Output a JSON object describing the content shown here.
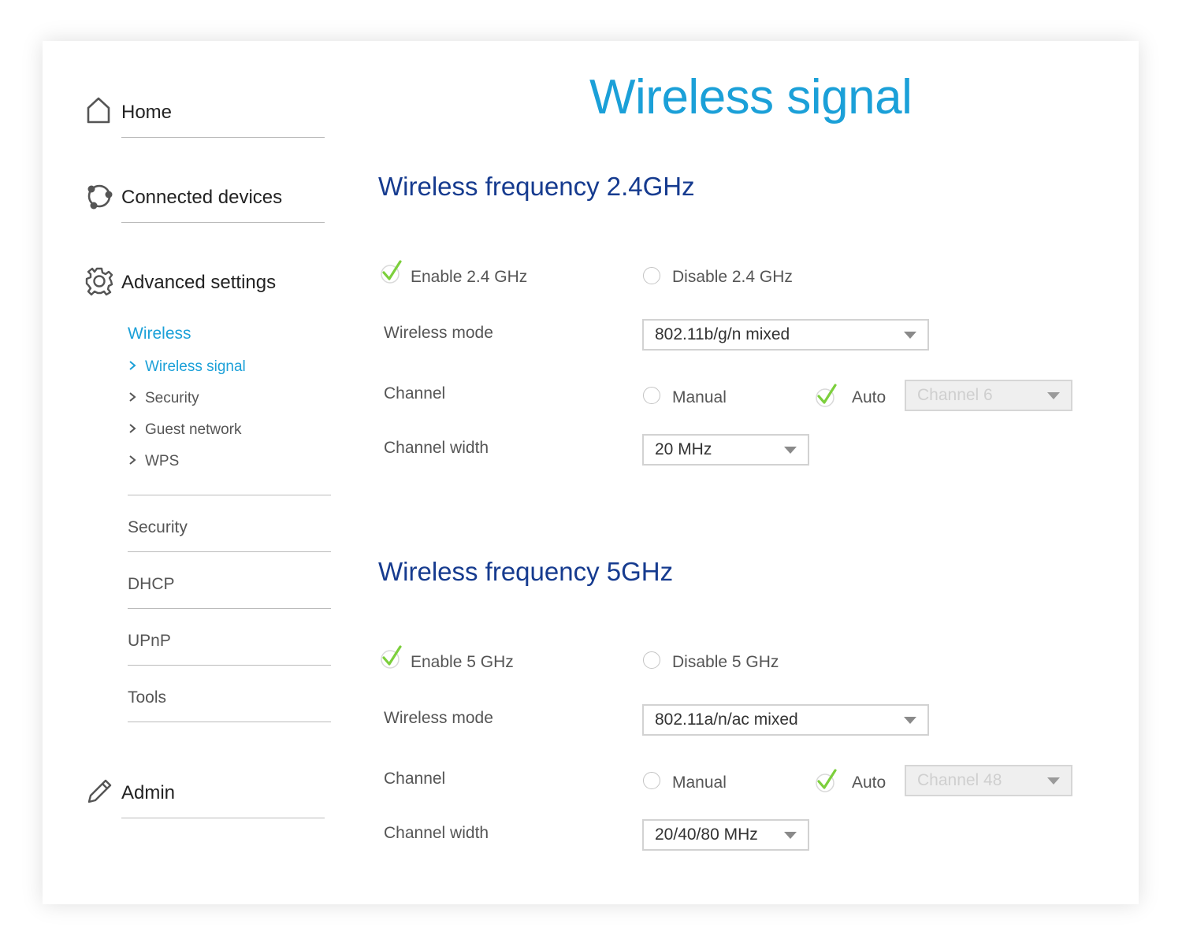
{
  "page": {
    "title": "Wireless signal"
  },
  "sidebar": {
    "home": "Home",
    "connected_devices": "Connected devices",
    "advanced_settings": "Advanced settings",
    "wireless_heading": "Wireless",
    "wireless_items": [
      "Wireless signal",
      "Security",
      "Guest network",
      "WPS"
    ],
    "advanced_items": [
      "Security",
      "DHCP",
      "UPnP",
      "Tools"
    ],
    "admin": "Admin",
    "active_item": "Wireless signal"
  },
  "band24": {
    "title": "Wireless frequency 2.4GHz",
    "enable_label": "Enable 2.4 GHz",
    "disable_label": "Disable 2.4 GHz",
    "mode_label": "Wireless mode",
    "mode_value": "802.11b/g/n mixed",
    "channel_label": "Channel",
    "manual_label": "Manual",
    "auto_label": "Auto",
    "channel_value": "Channel 6",
    "width_label": "Channel width",
    "width_value": "20 MHz"
  },
  "band5": {
    "title": "Wireless frequency 5GHz",
    "enable_label": "Enable 5 GHz",
    "disable_label": "Disable 5 GHz",
    "mode_label": "Wireless mode",
    "mode_value": "802.11a/n/ac mixed",
    "channel_label": "Channel",
    "manual_label": "Manual",
    "auto_label": "Auto",
    "channel_value": "Channel 48",
    "width_label": "Channel width",
    "width_value": "20/40/80 MHz"
  },
  "colors": {
    "accent": "#1ba0d8",
    "heading": "#163b8f",
    "check": "#7ccf3c"
  },
  "icons": [
    "home-icon",
    "connected-devices-icon",
    "gear-icon",
    "chevron-right-icon",
    "check-icon",
    "dropdown-arrow-icon",
    "pencil-icon"
  ]
}
